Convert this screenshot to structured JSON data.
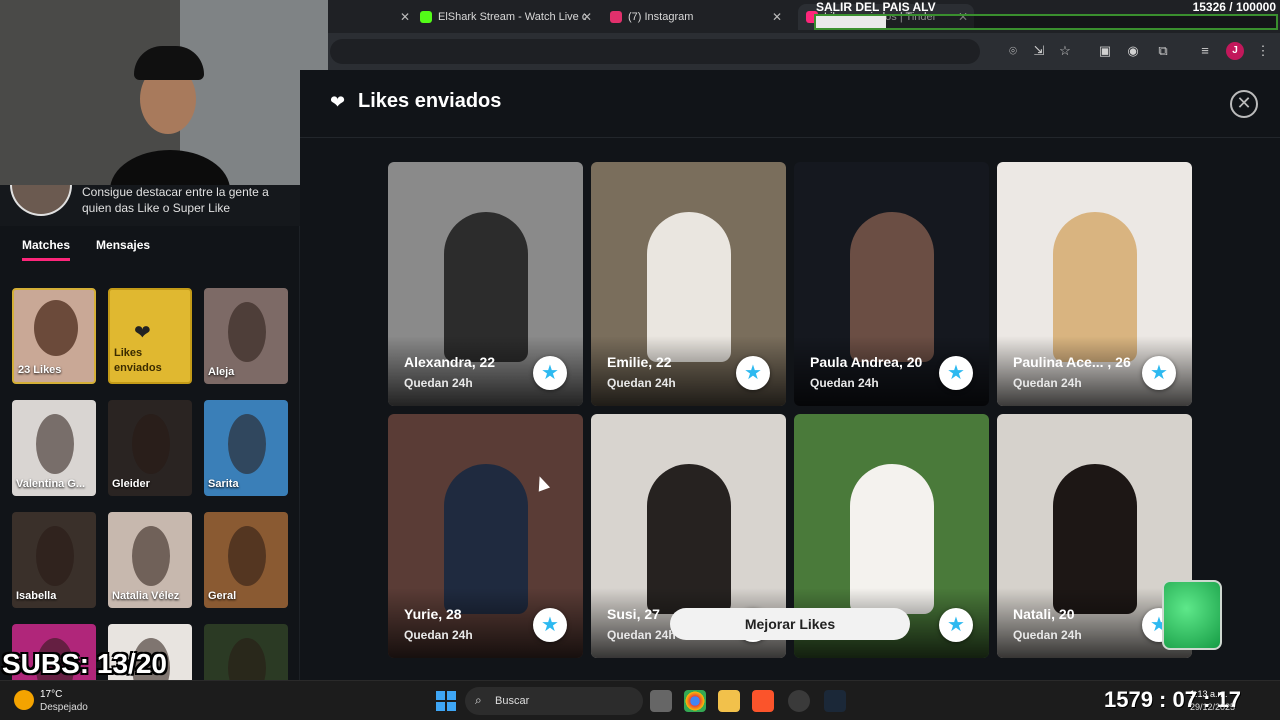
{
  "browser": {
    "tabs": [
      {
        "title": "ElShark Stream - Watch Live on",
        "color": "#53fc18"
      },
      {
        "title": "(7) Instagram",
        "color": "#e1306c"
      },
      {
        "title": "Likes enviados | Tinder",
        "color": "#fd267a"
      }
    ],
    "profile_initial": "J"
  },
  "stream_goal": {
    "title": "SALIR DEL PAIS ALV",
    "count": "15326  / 100000",
    "progress": 0.153
  },
  "sidebar": {
    "promo_text": "Consigue destacar entre la gente a quien das Like o Super Like",
    "tabs": [
      "Matches",
      "Mensajes"
    ],
    "likes_card": "23 Likes",
    "sent_card": "Likes enviados",
    "matches": [
      {
        "name": "Aleja",
        "color": "#7d6a66"
      },
      {
        "name": "Valentina G...",
        "color": "#d9d5d2"
      },
      {
        "name": "Gleider",
        "color": "#2a2422"
      },
      {
        "name": "Sarita",
        "color": "#3a7fb8"
      },
      {
        "name": "Isabella",
        "color": "#3a302a"
      },
      {
        "name": "Natalia Vélez",
        "color": "#c7b8ae"
      },
      {
        "name": "Geral",
        "color": "#8a5a32"
      },
      {
        "name": "",
        "color": "#b0267a"
      },
      {
        "name": "",
        "color": "#e8e4e0"
      },
      {
        "name": "",
        "color": "#2b3a24"
      }
    ]
  },
  "main": {
    "title": "Likes enviados",
    "upgrade_button": "Mejorar Likes",
    "profiles": [
      {
        "name": "Alexandra, 22",
        "time": "Quedan 24h",
        "bg": "#8a8a8a",
        "accent": "#2c2c2c"
      },
      {
        "name": "Emilie, 22",
        "time": "Quedan 24h",
        "bg": "#7a6e5c",
        "accent": "#eae6e0"
      },
      {
        "name": "Paula Andrea, 20",
        "time": "Quedan 24h",
        "bg": "#15181f",
        "accent": "#6b4e44"
      },
      {
        "name": "Paulina Ace... , 26",
        "time": "Quedan 24h",
        "bg": "#ece8e4",
        "accent": "#d9b480"
      },
      {
        "name": "Yurie, 28",
        "time": "Quedan 24h",
        "bg": "#5a3c36",
        "accent": "#1f2a3f"
      },
      {
        "name": "Susi, 27",
        "time": "Quedan 24h",
        "bg": "#d8d4cf",
        "accent": "#262220"
      },
      {
        "name": "",
        "time": "",
        "bg": "#4a7a3a",
        "accent": "#f4f2ee"
      },
      {
        "name": "Natali, 20",
        "time": "Quedan 24h",
        "bg": "#d6d2cc",
        "accent": "#1d1715"
      }
    ]
  },
  "overlay": {
    "subs": "SUBS: 13/20",
    "timer": "1579 : 07 : 17"
  },
  "taskbar": {
    "weather_temp": "17°C",
    "weather_desc": "Despejado",
    "search": "Buscar",
    "time": "1:13 a.m.",
    "date": "29/12/2025"
  }
}
